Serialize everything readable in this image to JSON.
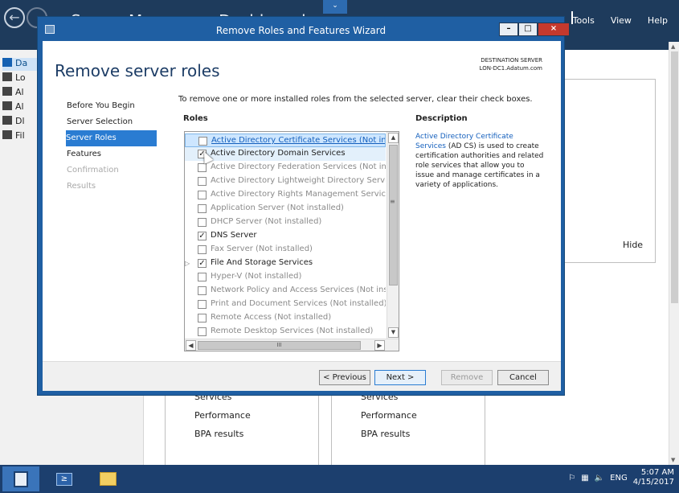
{
  "server_manager": {
    "title": "Server Manager • Dashboard",
    "menu": [
      "Tools",
      "View",
      "Help"
    ],
    "nav_items": [
      "Da",
      "Lo",
      "Al",
      "Al",
      "Dl",
      "Fil"
    ],
    "right_panel": {
      "hide_label": "Hide"
    },
    "cards": [
      {
        "lines": [
          "Services",
          "Performance",
          "BPA results"
        ]
      },
      {
        "lines": [
          "Services",
          "Performance",
          "BPA results"
        ]
      }
    ]
  },
  "wizard": {
    "title": "Remove Roles and Features Wizard",
    "header": "Remove server roles",
    "destination_label": "DESTINATION SERVER",
    "destination_server": "LON-DC1.Adatum.com",
    "steps": [
      {
        "label": "Before You Begin",
        "state": "normal"
      },
      {
        "label": "Server Selection",
        "state": "normal"
      },
      {
        "label": "Server Roles",
        "state": "current"
      },
      {
        "label": "Features",
        "state": "normal"
      },
      {
        "label": "Confirmation",
        "state": "disabled"
      },
      {
        "label": "Results",
        "state": "disabled"
      }
    ],
    "instruction": "To remove one or more installed roles from the selected server, clear their check boxes.",
    "roles_heading": "Roles",
    "description_heading": "Description",
    "description_link": "Active Directory Certificate Services",
    "description_rest": "(AD CS) is used to create certification authorities and related role services that allow you to issue and manage certificates in a variety of applications.",
    "roles": [
      {
        "label": "Active Directory Certificate Services (Not installed)",
        "checked": false,
        "installed": false,
        "selected": true
      },
      {
        "label": "Active Directory Domain Services",
        "checked": true,
        "installed": true,
        "hover": true
      },
      {
        "label": "Active Directory Federation Services (Not installed)",
        "checked": false,
        "installed": false
      },
      {
        "label": "Active Directory Lightweight Directory Services (Not installed)",
        "checked": false,
        "installed": false
      },
      {
        "label": "Active Directory Rights Management Services (Not installed)",
        "checked": false,
        "installed": false
      },
      {
        "label": "Application Server (Not installed)",
        "checked": false,
        "installed": false
      },
      {
        "label": "DHCP Server (Not installed)",
        "checked": false,
        "installed": false
      },
      {
        "label": "DNS Server",
        "checked": true,
        "installed": true
      },
      {
        "label": "Fax Server (Not installed)",
        "checked": false,
        "installed": false
      },
      {
        "label": "File And Storage Services",
        "checked": true,
        "installed": true,
        "expandable": true
      },
      {
        "label": "Hyper-V (Not installed)",
        "checked": false,
        "installed": false
      },
      {
        "label": "Network Policy and Access Services (Not installed)",
        "checked": false,
        "installed": false
      },
      {
        "label": "Print and Document Services (Not installed)",
        "checked": false,
        "installed": false
      },
      {
        "label": "Remote Access (Not installed)",
        "checked": false,
        "installed": false
      },
      {
        "label": "Remote Desktop Services (Not installed)",
        "checked": false,
        "installed": false
      }
    ],
    "buttons": {
      "previous": "< Previous",
      "next": "Next >",
      "remove": "Remove",
      "cancel": "Cancel"
    },
    "hscroll_grip": "III"
  },
  "taskbar": {
    "language": "ENG",
    "time": "5:07 AM",
    "date": "4/15/2017"
  }
}
